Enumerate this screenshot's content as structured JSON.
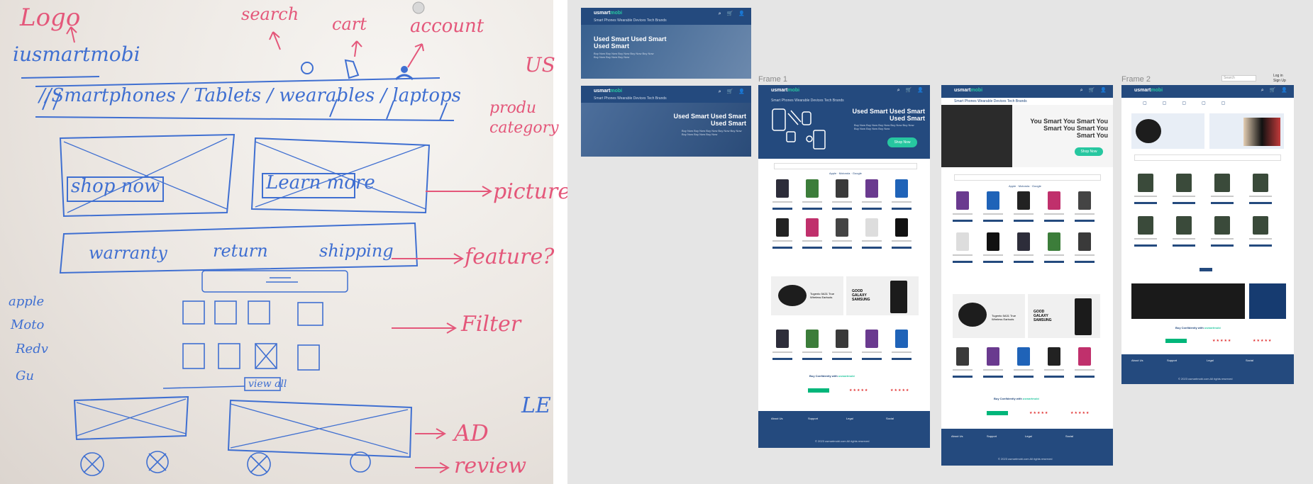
{
  "whiteboard": {
    "labels": {
      "logo": "Logo",
      "brand": "iusmartmobi",
      "search": "search",
      "cart": "cart",
      "account": "account",
      "us": "US",
      "products": "produ",
      "category": "category",
      "categories": "//Smartphones / Tablets / wearables / laptops",
      "shop_now": "shop now",
      "learn_more": "Learn more",
      "picture": "picture",
      "warranty": "warranty",
      "return": "return",
      "shipping": "shipping",
      "feature": "feature?",
      "filter": "Filter",
      "view_all": "view all",
      "ad": "AD",
      "review": "review",
      "brand_list": [
        "apple",
        "Moto",
        "Redv",
        "Gu"
      ],
      "le": "LE"
    }
  },
  "canvas": {
    "frame1_label": "Frame 1",
    "frame2_label": "Frame 2",
    "brand_prefix": "usmart",
    "brand_suffix": "mobi",
    "nav_links": "Smart Phones   Wearable Devices   Tech   Brands",
    "hero_title_1": "Used Smart Used Smart Used Smart",
    "hero_title_2": "Used Smart Used Smart Used Smart",
    "hero_title_3": "You Smart You Smart You Smart You Smart You Smart You",
    "hero_sub": "Buy Now Buy Now Buy Now Buy Now Buy Now Buy Now Buy Now Buy Now",
    "shop_now": "Shop Now",
    "ad_left": "Tugento 5A31 True Wireless Earbuds",
    "ad_right": "GOOD GALAXY SAMSUNG",
    "trust_title_prefix": "Buy Confidently with ",
    "trust_title_brand": "usmartmobi",
    "trustpilot": "Trustpilot",
    "reviews_io": "Reviews.io",
    "sitejabber": "sitejabber",
    "tabs": [
      "Apple",
      "Motorola",
      "Google"
    ],
    "footer_cols": [
      "About Us",
      "Support",
      "Legal",
      "Social"
    ],
    "copyright": "© 2023 usmartmobi.com All rights reserved",
    "frame2_login": "Log in",
    "frame2_signup": "Sign Up",
    "frame2_search": "Search"
  }
}
